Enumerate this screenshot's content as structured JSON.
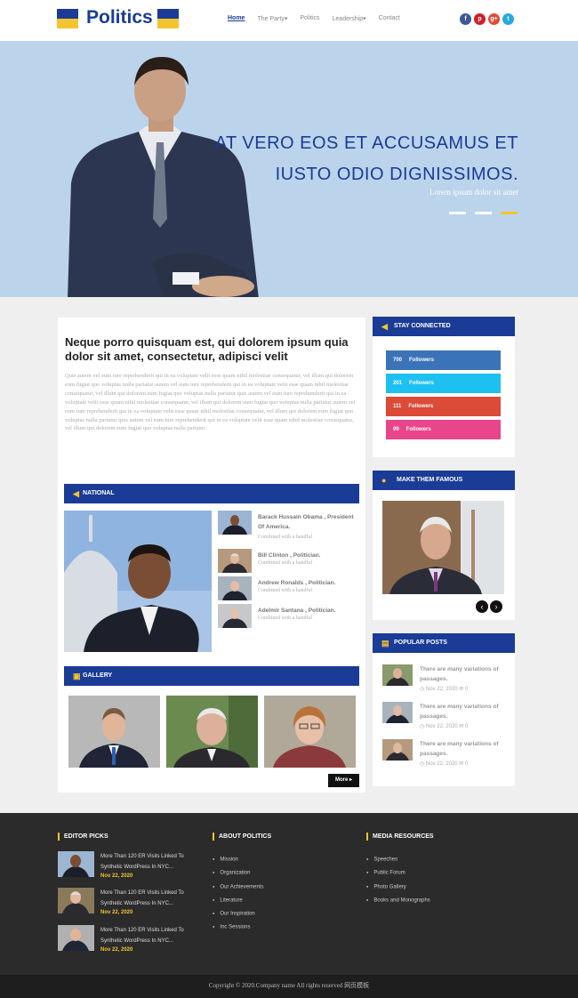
{
  "header": {
    "logo_text": "Politics",
    "nav": [
      "Home",
      "The Party",
      "Politics",
      "Leadership",
      "Contact"
    ],
    "nav_active": "Home",
    "socials": [
      "facebook-icon",
      "pinterest-icon",
      "google-plus-icon",
      "twitter-icon"
    ]
  },
  "hero": {
    "title": "AT VERO EOS ET ACCUSAMUS ET IUSTO ODIO DIGNISSIMOS.",
    "subtitle": "Lorem ipsum dolor sit amet",
    "slides": 3,
    "active_slide": 3
  },
  "article": {
    "title": "Neque porro quisquam est, qui dolorem ipsum quia dolor sit amet, consectetur, adipisci velit",
    "body": "Quis autem vel eum iure reprehenderit qui in ea voluptate velit esse quam nihil molestiae consequatur, vel illum qui dolorem eum fugiat quo voluptas nulla pariatur autem vel eum iure reprehenderit qui in ea voluptate velit esse quam nihil molestiae consequatur, vel illum qui dolorem eum fugiat quo voluptas nulla pariatur quis autem vel eum iure reprehenderit qui in ea voluptate velit esse quam nihil molestiae consequatur, vel illum qui dolorem eum fugiat quo voluptas nulla pariatur autem vel eum iure reprehenderit qui in ea voluptate velit esse quam nihil molestiae consequatur, vel illum qui dolorem eum fugiat quo voluptas nulla pariatur quis autem vel eum iure reprehenderit qui in ea voluptate velit esse quam nihil molestiae consequatur, vel illum qui dolorem eum fugiat quo voluptas nulla pariatur."
  },
  "national": {
    "heading": "NATIONAL",
    "items": [
      {
        "name": "Barack Hussain Obama , President Of America.",
        "sub": "Combined with a handful"
      },
      {
        "name": "Bill Clinton , Politician.",
        "sub": "Combined with a handful"
      },
      {
        "name": "Andrew Ronalds , Politician.",
        "sub": "Combined with a handful"
      },
      {
        "name": "Adelmir Santana , Politician.",
        "sub": "Combined with a handful"
      }
    ]
  },
  "gallery": {
    "heading": "GALLERY",
    "more_label": "More"
  },
  "stay_connected": {
    "heading": "STAY CONNECTED",
    "items": [
      {
        "count": "700",
        "label": "Followers",
        "color": "#3b73b9"
      },
      {
        "count": "201",
        "label": "Followers",
        "color": "#1ec0f0"
      },
      {
        "count": "111",
        "label": "Followers",
        "color": "#dc4a38"
      },
      {
        "count": "99",
        "label": "Followers",
        "color": "#e8458b"
      }
    ]
  },
  "famous": {
    "heading": "MAKE THEM FAMOUS"
  },
  "popular": {
    "heading": "POPULAR POSTS",
    "items": [
      {
        "title": "There are many variations of passages.",
        "date": "Nov 22, 2020",
        "comments": "0"
      },
      {
        "title": "There are many variations of passages.",
        "date": "Nov 22, 2020",
        "comments": "0"
      },
      {
        "title": "There are many variations of passages.",
        "date": "Nov 22, 2020",
        "comments": "0"
      }
    ]
  },
  "footer": {
    "editor_heading": "EDITOR PICKS",
    "editor_items": [
      {
        "title": "More Than 120 ER Visits Linked To Synthetic WordPress In NYC...",
        "date": "Nov 22, 2020"
      },
      {
        "title": "More Than 120 ER Visits Linked To Synthetic WordPress In NYC...",
        "date": "Nov 22, 2020"
      },
      {
        "title": "More Than 120 ER Visits Linked To Synthetic WordPress In NYC...",
        "date": "Nov 22, 2020"
      }
    ],
    "about_heading": "ABOUT POLITICS",
    "about_links": [
      "Mission",
      "Organization",
      "Our Achievements",
      "Literature",
      "Our Inspiration",
      "Inc Sessions"
    ],
    "media_heading": "MEDIA RESOURCES",
    "media_links": [
      "Speeches",
      "Public Forum",
      "Photo Gallery",
      "Books and Monographs"
    ],
    "copyright": "Copyright © 2020.Company name All rights reserved 网页模板"
  },
  "colors": {
    "brand": "#1a3b96",
    "accent": "#f4c430",
    "footer": "#2b2b2b"
  }
}
